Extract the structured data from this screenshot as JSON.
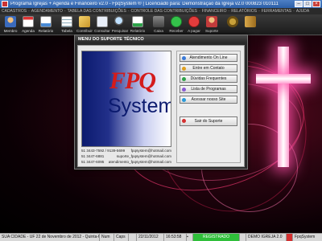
{
  "window": {
    "title": "Programa Igrejas + Agenda e Financeiro v2.0 - FpqSystem ® | Licenciado para: Demonstração da Igreja v2.0 000823 010111"
  },
  "menubar": {
    "items": [
      "CADASTROS",
      "AGENDAMENTO",
      "TABELA DAS CONTRIBUIÇÕES",
      "CONTROLE DAS CONTRIBUIÇÕES",
      "FINANCEIRO",
      "RELATÓRIOS",
      "FERRAMENTAS",
      "AJUDA"
    ]
  },
  "toolbar": {
    "membro": "Membro",
    "agenda": "Agenda",
    "relatorio": "Relatório",
    "tabela": "Tabela",
    "contribuir": "Contribuir",
    "consultar": "Consultar",
    "pesquisar": "Pesquisar",
    "relatorio2": "Relatório",
    "caixa": "Caixa",
    "receber": "Receber",
    "a_pagar": "A pagar",
    "suporte": "Suporte"
  },
  "dialog": {
    "title": "MENU DO SUPORTE TÉCNICO",
    "logo_top": "FPQ",
    "logo_bottom": "System",
    "contacts": [
      {
        "phone": "51 3443-7592 / 9139-5699",
        "email": "fpqsystem@hotmail.com"
      },
      {
        "phone": "51 3447-6881",
        "email": "suporte_fpqsystem@hotmail.com"
      },
      {
        "phone": "51 3447-6095",
        "email": "atendimento_fpqsystem@hotmail.com"
      }
    ],
    "buttons": {
      "online": "Atendimento On Line",
      "contato": "Entre em Contato",
      "duvidas": "Dúvidas Frequentes",
      "lista": "Lista de Programas",
      "site": "Acessar nosso Site",
      "exit": "Sair do Suporte"
    }
  },
  "statusbar": {
    "city": "SUA CIDADE - UF 22 de Novembro de 2012 - Quinta-feira",
    "num": "Num",
    "caps": "Caps",
    "date": "22/11/2012",
    "time": "16:53:58",
    "registered": "REGISTRADO",
    "version": "DEMO IGREJA 2.0",
    "brand": "FpqSystem"
  }
}
